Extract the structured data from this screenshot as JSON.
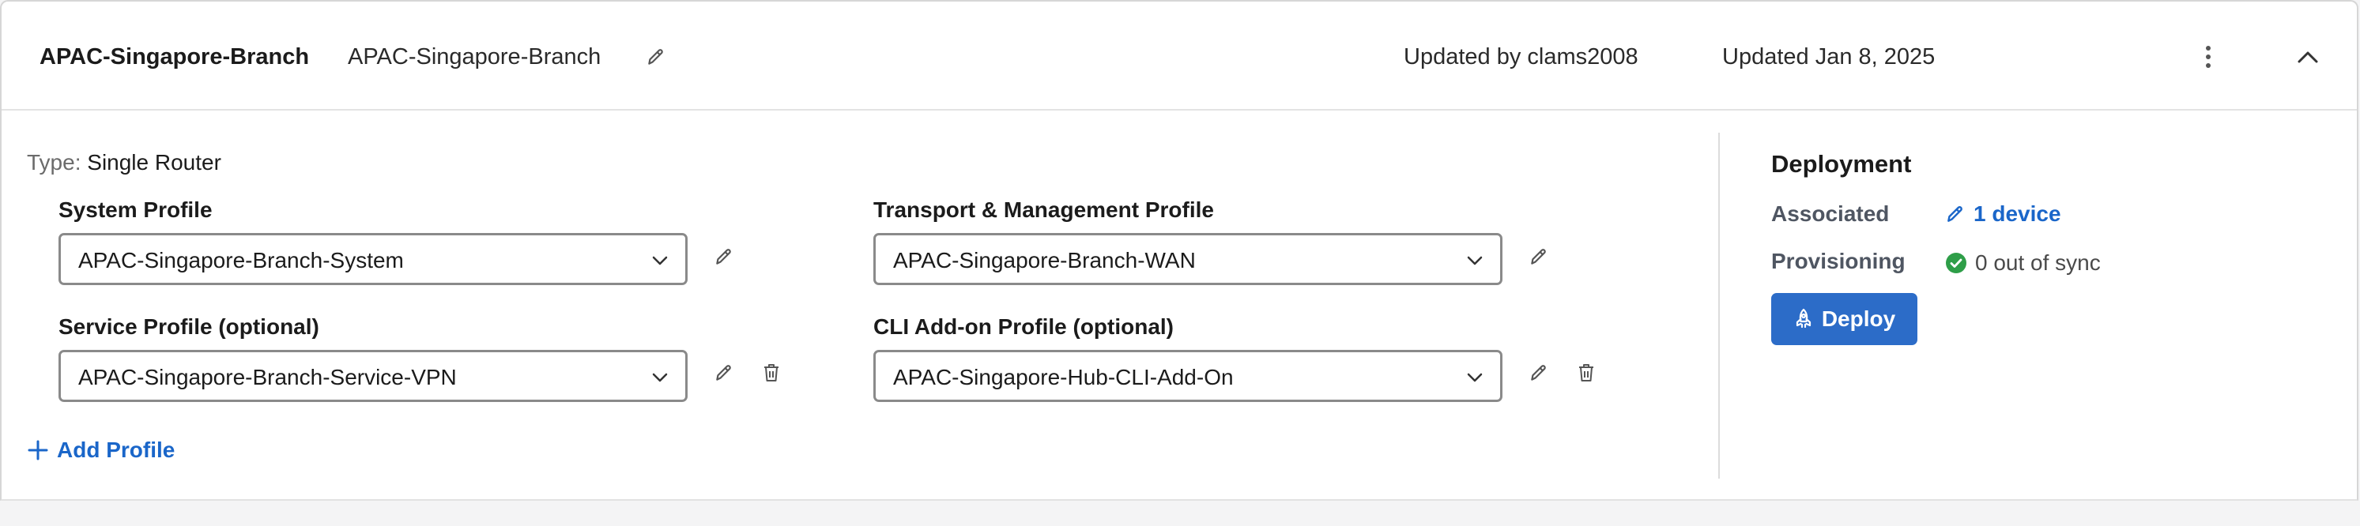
{
  "header": {
    "title": "APAC-Singapore-Branch",
    "name": "APAC-Singapore-Branch",
    "updated_by": "Updated by clams2008",
    "updated_on": "Updated Jan 8, 2025",
    "icons": {
      "edit": "pencil-icon",
      "more": "more-vertical-icon",
      "collapse": "chevron-up-icon"
    }
  },
  "type": {
    "label": "Type:",
    "value": "Single Router"
  },
  "profiles": {
    "system": {
      "label": "System Profile",
      "value": "APAC-Singapore-Branch-System"
    },
    "transport": {
      "label": "Transport & Management Profile",
      "value": "APAC-Singapore-Branch-WAN"
    },
    "service": {
      "label": "Service Profile (optional)",
      "value": "APAC-Singapore-Branch-Service-VPN"
    },
    "cli": {
      "label": "CLI Add-on Profile (optional)",
      "value": "APAC-Singapore-Hub-CLI-Add-On"
    }
  },
  "add_profile_label": "Add Profile",
  "deployment": {
    "title": "Deployment",
    "associated_label": "Associated",
    "associated_value": "1 device",
    "provisioning_label": "Provisioning",
    "provisioning_value": "0 out of sync",
    "deploy_label": "Deploy"
  },
  "colors": {
    "accent": "#1a66c9",
    "deploy_button": "#2c6cc8",
    "success": "#2e9e48",
    "border": "#8a8a8a"
  }
}
